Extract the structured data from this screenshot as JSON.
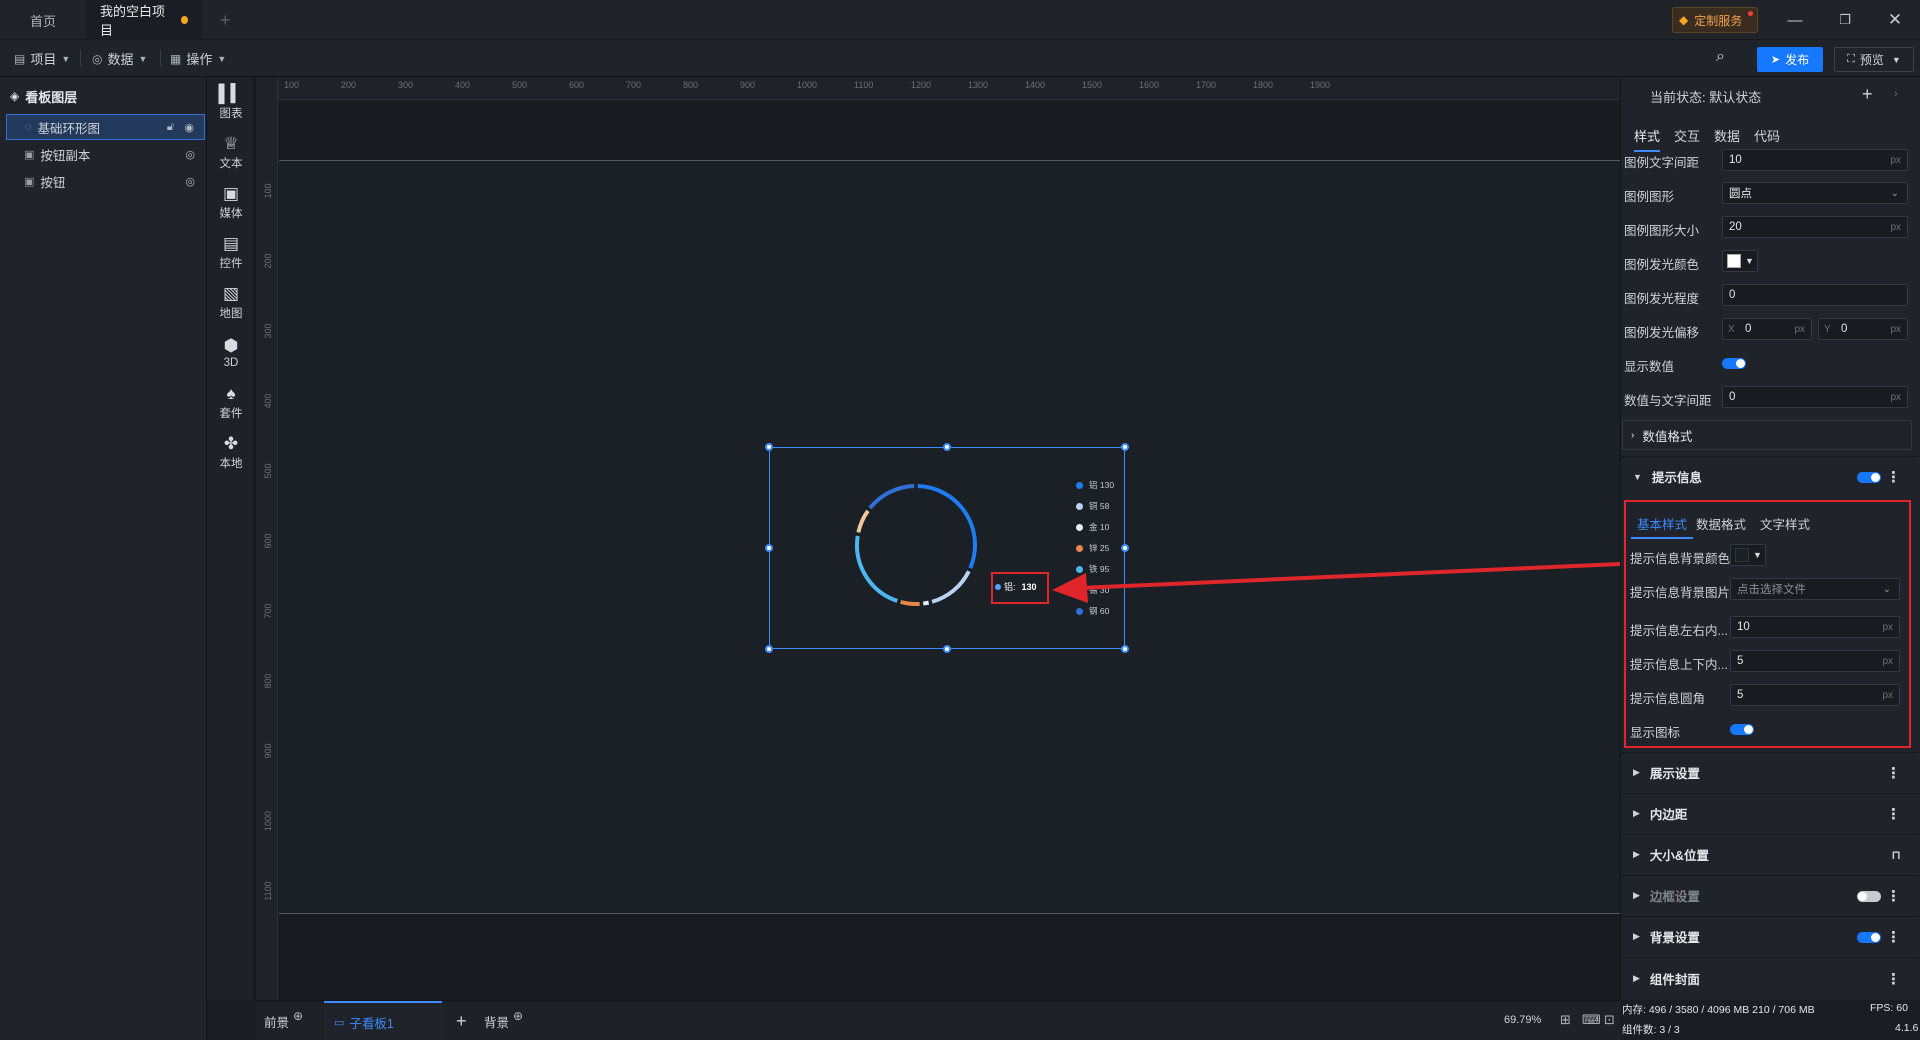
{
  "tabs": {
    "home": "首页",
    "project": "我的空白项目",
    "add": "+"
  },
  "custom_service": "定制服务",
  "menu": {
    "project": "项目",
    "data": "数据",
    "operation": "操作"
  },
  "publish": "发布",
  "preview": "预览",
  "layers": {
    "title": "看板图层",
    "items": [
      {
        "label": "基础环形图"
      },
      {
        "label": "按钮副本"
      },
      {
        "label": "按钮"
      }
    ]
  },
  "tools": [
    {
      "label": "图表"
    },
    {
      "label": "文本"
    },
    {
      "label": "媒体"
    },
    {
      "label": "控件"
    },
    {
      "label": "地图"
    },
    {
      "label": "3D"
    },
    {
      "label": "套件"
    },
    {
      "label": "本地"
    }
  ],
  "ruler_top": [
    "100",
    "200",
    "300",
    "400",
    "500",
    "600",
    "700",
    "800",
    "900",
    "1000",
    "1100",
    "1200",
    "1300",
    "1400",
    "1500",
    "1600",
    "1700",
    "1800",
    "1900"
  ],
  "ruler_left": [
    "100",
    "200",
    "300",
    "400",
    "500",
    "600",
    "700",
    "800",
    "900",
    "1000",
    "1100"
  ],
  "chart_data": {
    "type": "pie",
    "title": "",
    "categories": [
      "铝",
      "铜",
      "金",
      "锌",
      "铁",
      "锡",
      "钢"
    ],
    "values": [
      130,
      58,
      10,
      25,
      95,
      30,
      60
    ],
    "colors": [
      "#1e7cf0",
      "#b9d3f2",
      "#e9eef5",
      "#e8874a",
      "#4cb6ef",
      "#f1c89a",
      "#2f6fd6"
    ]
  },
  "legend": [
    {
      "label": "铝 130"
    },
    {
      "label": "铜 58"
    },
    {
      "label": "金 10"
    },
    {
      "label": "锌 25"
    },
    {
      "label": "铁 95"
    },
    {
      "label": "锡 30"
    },
    {
      "label": "钢 60"
    }
  ],
  "tooltip": {
    "name": "铝:",
    "value": "130"
  },
  "bottom": {
    "front": "前景",
    "sub": "子看板1",
    "add": "+",
    "bg": "背景"
  },
  "zoom": "69.79%",
  "panel": {
    "state": "当前状态:  默认状态",
    "tabs": [
      "样式",
      "交互",
      "数据",
      "代码"
    ],
    "rows": [
      {
        "label": "图例文字间距",
        "value": "10",
        "unit": "px"
      },
      {
        "label": "图例图形",
        "value": "圆点"
      },
      {
        "label": "图例图形大小",
        "value": "20",
        "unit": "px"
      },
      {
        "label": "图例发光颜色"
      },
      {
        "label": "图例发光程度",
        "value": "0"
      },
      {
        "label": "图例发光偏移",
        "x": "0",
        "y": "0",
        "x_label": "X",
        "y_label": "Y",
        "unit": "px"
      },
      {
        "label": "显示数值"
      },
      {
        "label": "数值与文字间距",
        "value": "0",
        "unit": "px"
      }
    ],
    "value_format": "数值格式",
    "tooltip_section": "提示信息",
    "subtabs": [
      "基本样式",
      "数据格式",
      "文字样式"
    ],
    "tip_rows": [
      {
        "label": "提示信息背景颜色"
      },
      {
        "label": "提示信息背景图片",
        "value": "点击选择文件"
      },
      {
        "label": "提示信息左右内...",
        "value": "10",
        "unit": "px"
      },
      {
        "label": "提示信息上下内...",
        "value": "5",
        "unit": "px"
      },
      {
        "label": "提示信息圆角",
        "value": "5",
        "unit": "px"
      },
      {
        "label": "显示图标"
      }
    ],
    "sections": [
      "展示设置",
      "内边距",
      "大小&位置",
      "边框设置",
      "背景设置",
      "组件封面"
    ]
  },
  "status": {
    "memory": "内存: 496 / 3580 / 4096 MB  210 / 706 MB",
    "components": "组件数: 3 / 3",
    "fps": "FPS: 60",
    "version": "4.1.6"
  }
}
